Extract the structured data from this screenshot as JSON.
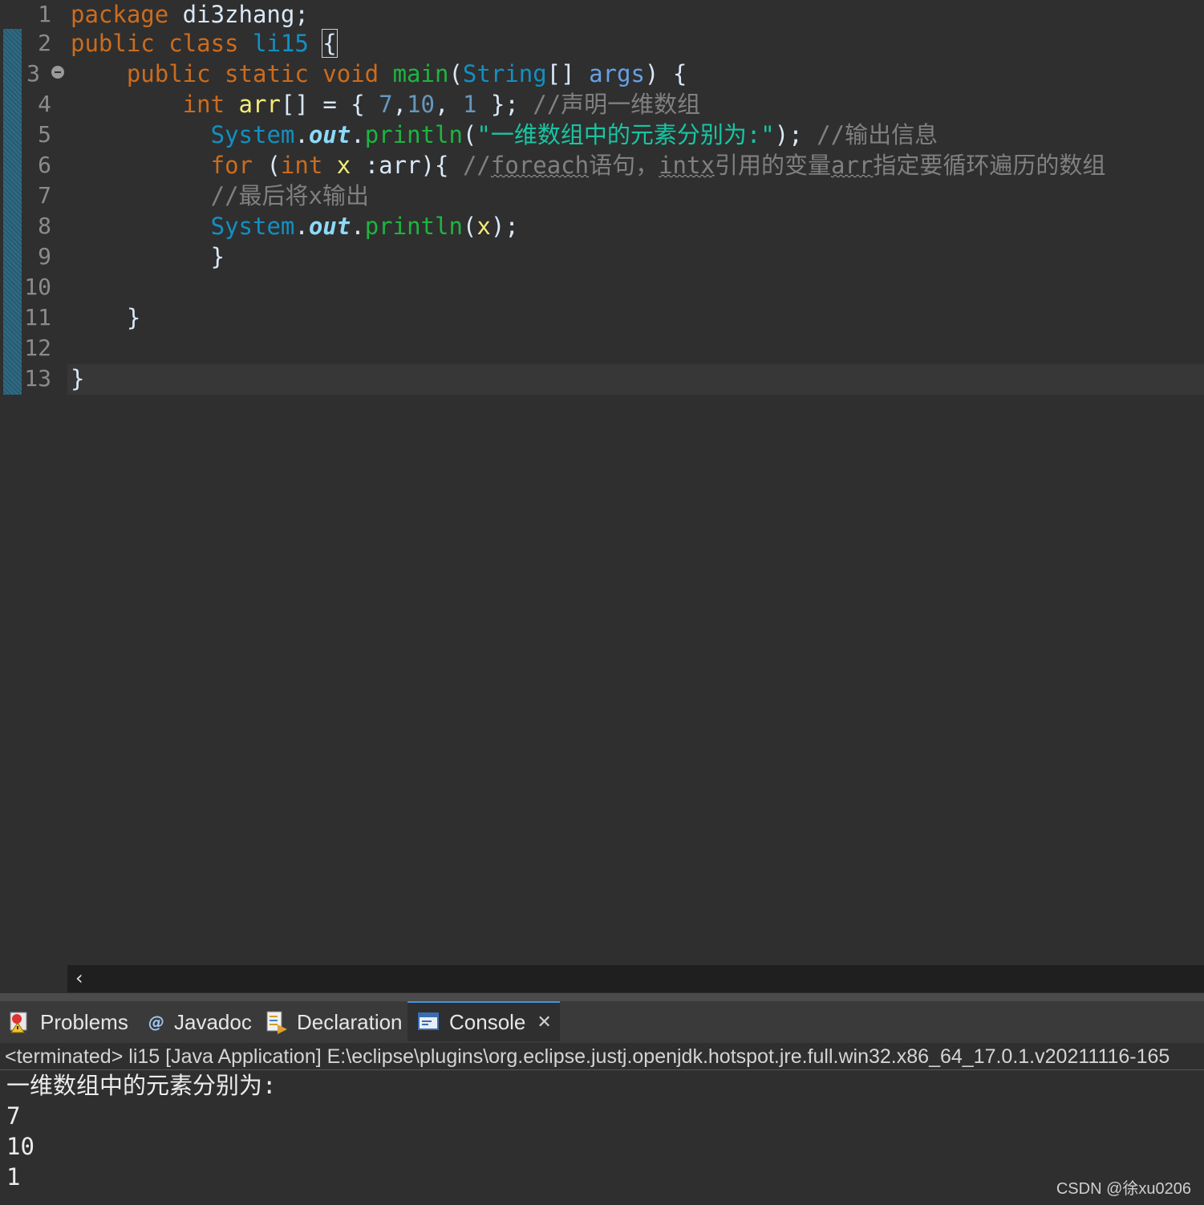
{
  "editor": {
    "line_numbers": [
      "1",
      "2",
      "3",
      "4",
      "5",
      "6",
      "7",
      "8",
      "9",
      "10",
      "11",
      "12",
      "13"
    ],
    "line1": {
      "kw": "package",
      "rest": " di3zhang;"
    },
    "line2": {
      "kw": "public class",
      "cls": "li15",
      "sp": " ",
      "brace": "{"
    },
    "line3": {
      "indent": "    ",
      "kw": "public static void",
      "sp": " ",
      "method": "main",
      "p1": "(",
      "cls": "String",
      "p2": "[] ",
      "param": "args",
      "p3": ") {"
    },
    "line4": {
      "indent": "        ",
      "kw": "int",
      "sp": " ",
      "var": "arr",
      "p1": "[] = { ",
      "n1": "7",
      "c1": ",",
      "n2": "10",
      "c2": ", ",
      "n3": "1",
      "p2": " }; ",
      "comment": "//声明一维数组"
    },
    "line5": {
      "indent": "          ",
      "cls": "System",
      "dot1": ".",
      "field": "out",
      "dot2": ".",
      "method": "println",
      "p1": "(",
      "str": "\"一维数组中的元素分别为:\"",
      "p2": "); ",
      "comment": "//输出信息"
    },
    "line6": {
      "indent": "          ",
      "kw": "for",
      "p1": " (",
      "kw2": "int",
      "sp": " ",
      "var": "x",
      "p2": " :arr){ ",
      "c1": "//",
      "c2": "foreach",
      "c3": "语句，",
      "c4": "intx",
      "c5": "引用的变量",
      "c6": "arr",
      "c7": "指定要循环遍历的数组"
    },
    "line7": {
      "indent": "          ",
      "comment": "//最后将x输出"
    },
    "line8": {
      "indent": "          ",
      "cls": "System",
      "dot1": ".",
      "field": "out",
      "dot2": ".",
      "method": "println",
      "p1": "(",
      "var": "x",
      "p2": ");"
    },
    "line9": {
      "text": "          }"
    },
    "line11": {
      "text": "    }"
    },
    "line13": {
      "text": "}"
    }
  },
  "scroll_left_glyph": "‹",
  "tabs": [
    {
      "label": "Problems",
      "icon": "problems-icon"
    },
    {
      "label": "Javadoc",
      "icon": "javadoc-icon"
    },
    {
      "label": "Declaration",
      "icon": "declaration-icon"
    },
    {
      "label": "Console",
      "icon": "console-icon",
      "active": true
    }
  ],
  "console": {
    "close_glyph": "✕",
    "header": "<terminated> li15 [Java Application] E:\\eclipse\\plugins\\org.eclipse.justj.openjdk.hotspot.jre.full.win32.x86_64_17.0.1.v20211116-165",
    "output": [
      "一维数组中的元素分别为:",
      "7",
      "10",
      "1"
    ]
  },
  "watermark": "CSDN @徐xu0206",
  "colors": {
    "background": "#2f2f2f",
    "keyword": "#cc6c1d",
    "class": "#1290c3",
    "method": "#1eb540",
    "string": "#17c6a3",
    "comment": "#808080",
    "number": "#6897bb"
  }
}
